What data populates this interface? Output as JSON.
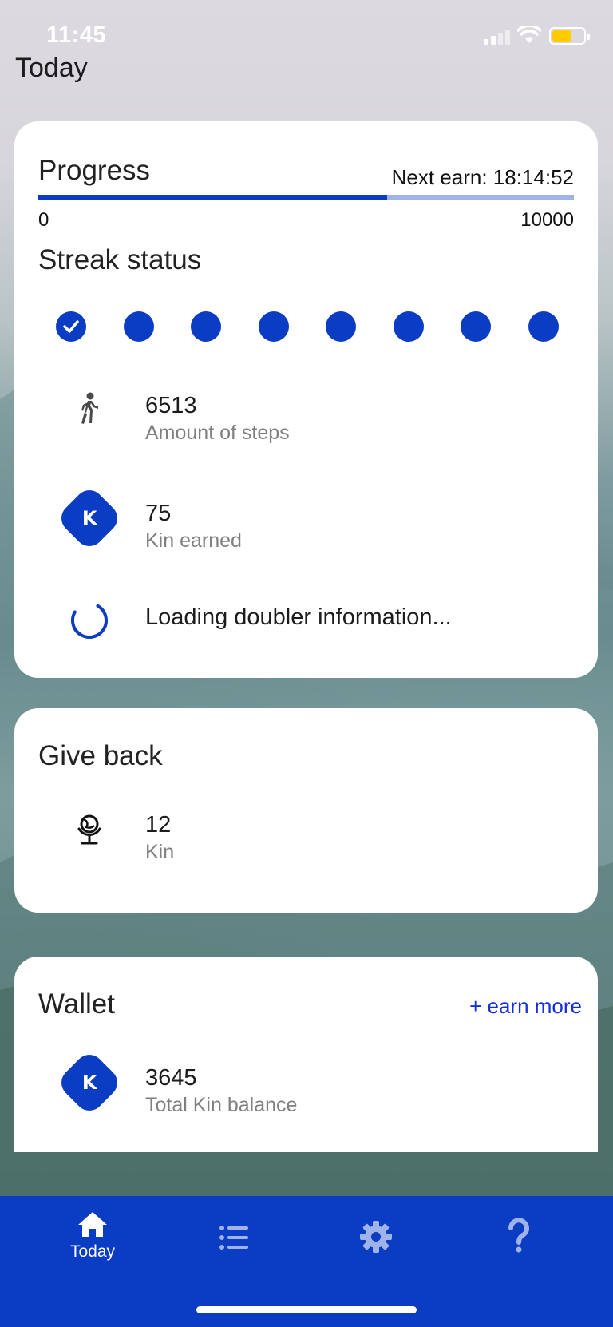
{
  "status_bar": {
    "time": "11:45"
  },
  "header": {
    "title": "Today"
  },
  "progress": {
    "title": "Progress",
    "next_earn": "Next earn: 18:14:52",
    "bar_min": "0",
    "bar_max": "10000",
    "current_steps": 6513
  },
  "streak": {
    "title": "Streak status",
    "days": [
      {
        "completed": true
      },
      {
        "completed": false
      },
      {
        "completed": false
      },
      {
        "completed": false
      },
      {
        "completed": false
      },
      {
        "completed": false
      },
      {
        "completed": false
      },
      {
        "completed": false
      }
    ]
  },
  "stats": {
    "steps": {
      "value": "6513",
      "label": "Amount of steps",
      "icon": "walking-icon"
    },
    "kin_earned": {
      "value": "75",
      "label": "Kin earned",
      "icon": "kin-icon"
    },
    "doubler": {
      "text": "Loading doubler information...",
      "icon": "loading-spinner-icon"
    }
  },
  "give_back": {
    "title": "Give back",
    "value": "12",
    "label": "Kin",
    "icon": "globe-icon"
  },
  "wallet": {
    "title": "Wallet",
    "earn_more": "+ earn more",
    "value": "3645",
    "label": "Total Kin balance",
    "icon": "kin-icon"
  },
  "tab_bar": {
    "tabs": [
      {
        "label": "Today",
        "icon": "home-icon",
        "active": true
      },
      {
        "label": "",
        "icon": "list-icon",
        "active": false
      },
      {
        "label": "",
        "icon": "gear-icon",
        "active": false
      },
      {
        "label": "",
        "icon": "help-icon",
        "active": false
      }
    ]
  },
  "colors": {
    "brand_blue": "#0a3cc4",
    "progress_track": "#9fb3e8",
    "link_blue": "#1530d8",
    "label_gray": "#808080"
  }
}
